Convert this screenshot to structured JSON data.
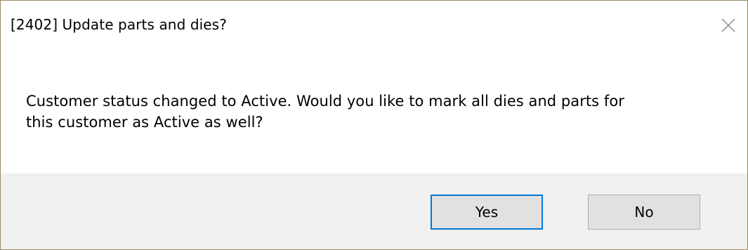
{
  "dialog": {
    "title": "[2402] Update parts and dies?",
    "close_icon": "close-icon",
    "message_line1": "Customer status changed to Active. Would you like to mark all dies and parts for",
    "message_line2": "this customer as Active as well?",
    "buttons": {
      "yes_label": "Yes",
      "no_label": "No"
    },
    "colors": {
      "footer_background": "#f0f0f0",
      "button_background": "#e1e1e1",
      "default_button_border": "#0078d7",
      "window_border": "#9a8b63"
    }
  }
}
